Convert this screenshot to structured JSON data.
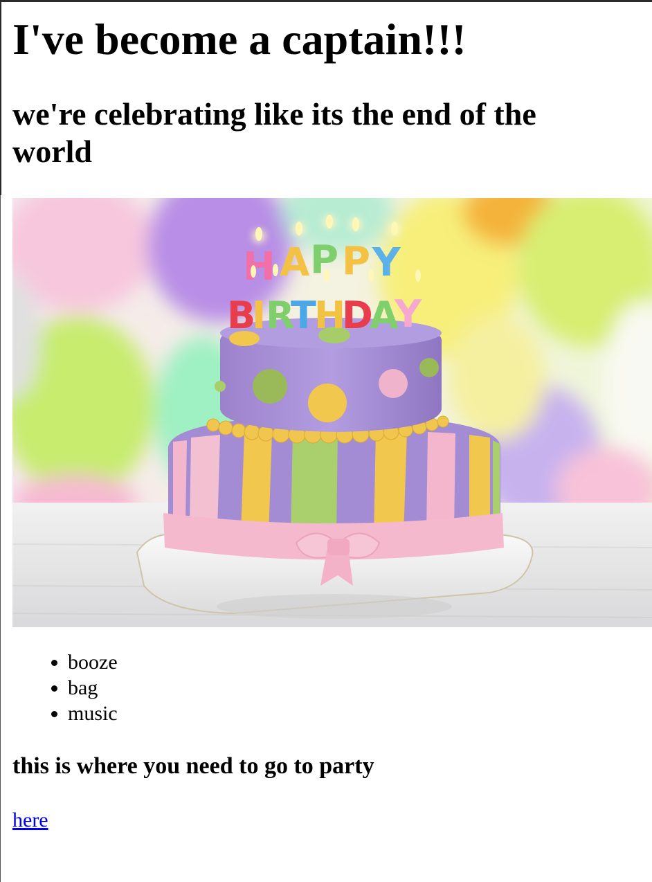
{
  "page": {
    "heading": "I've become a captain!!!",
    "subheading": "we're celebrating like its the end of the world",
    "hero_image": {
      "subject": "two-tier birthday cake with HAPPY BIRTHDAY candles and balloons",
      "candle_text_top": "HAPPY",
      "candle_text_bottom": "BIRTHDAY",
      "colors": {
        "cake_top": "#a98fd6",
        "stripe_yellow": "#f2c84b",
        "stripe_green": "#a8cf6a",
        "stripe_pink": "#f3b6cc",
        "ribbon": "#f4b9cd"
      }
    },
    "list_items": [
      "booze",
      "bag",
      "music"
    ],
    "party_heading": "this is where you need to go to party",
    "link_text": "here",
    "link_color": "#0000ee"
  }
}
